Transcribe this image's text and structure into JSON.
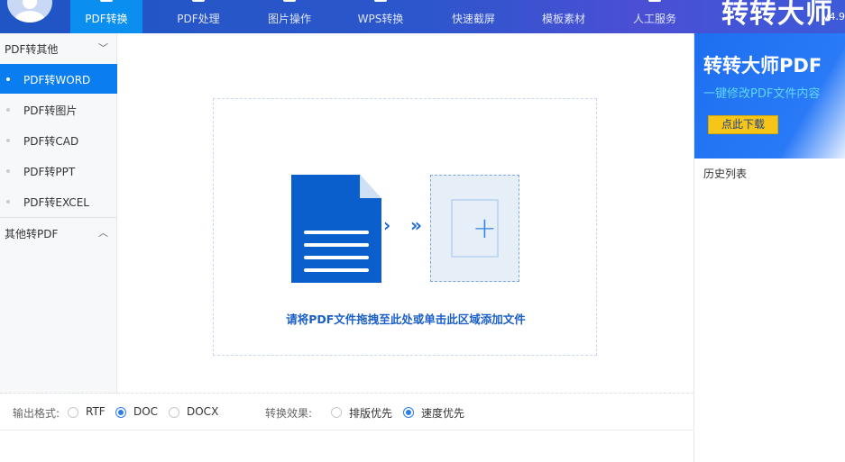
{
  "header": {
    "tabs": [
      "PDF转换",
      "PDF处理",
      "图片操作",
      "WPS转换",
      "快速截屏",
      "模板素材",
      "人工服务"
    ],
    "active_tab": 0,
    "logo": "转转大师",
    "version": "V4.9"
  },
  "sidebar": {
    "group1": "PDF转其他",
    "items": [
      "PDF转WORD",
      "PDF转图片",
      "PDF转CAD",
      "PDF转PPT",
      "PDF转EXCEL"
    ],
    "group2": "其他转PDF"
  },
  "main": {
    "hint": "请将PDF文件拖拽至此处或单击此区域添加文件"
  },
  "right": {
    "banner_title": "转转大师PDF",
    "banner_sub": "一键修改PDF文件内容",
    "banner_button": "点此下载",
    "history": "历史列表"
  },
  "bottom": {
    "format_label": "输出格式:",
    "formats": [
      "RTF",
      "DOC",
      "DOCX"
    ],
    "format_selected": "DOC",
    "effect_label": "转换效果:",
    "effects": [
      "排版优先",
      "速度优先"
    ],
    "effect_selected": "速度优先"
  },
  "colors": {
    "header": "#2456c6",
    "active": "#0a8ff0",
    "accent": "#1a5fc8"
  }
}
